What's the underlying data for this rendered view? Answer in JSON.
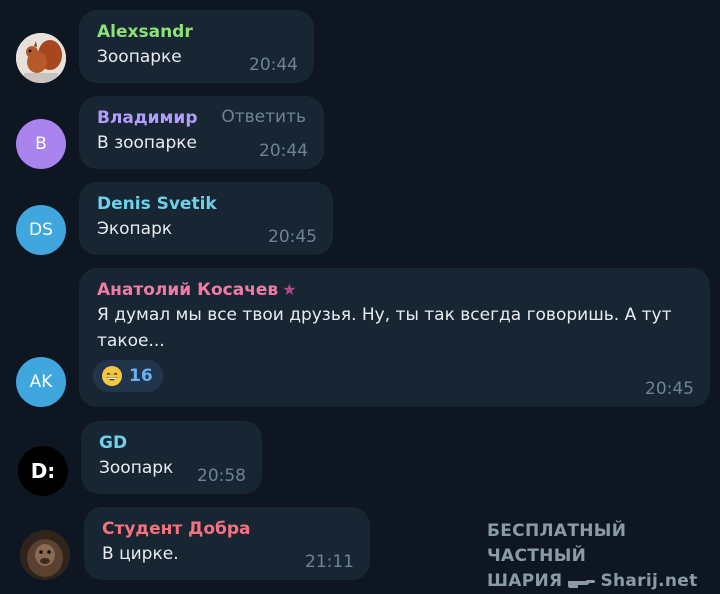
{
  "messages": [
    {
      "sender": "Alexsandr",
      "text": "Зоопарке",
      "time": "20:44",
      "color": "#8ee07a",
      "avatar": {
        "kind": "image",
        "icon": "squirrel-icon"
      }
    },
    {
      "sender": "Владимир",
      "text": "В зоопарке",
      "time": "20:44",
      "color": "#b29dfb",
      "reply": "Ответить",
      "avatar": {
        "kind": "initials",
        "initials": "B",
        "bg": "#a983ee"
      }
    },
    {
      "sender": "Denis Svetik",
      "text": "Экопарк",
      "time": "20:45",
      "color": "#6fd0e8",
      "avatar": {
        "kind": "initials",
        "initials": "DS",
        "bg": "#3fa7de"
      }
    },
    {
      "sender": "Анатолий Косачев",
      "text": "Я думал мы все твои друзья. Ну, ты так всегда говоришь. А тут такое...",
      "time": "20:45",
      "color": "#f27aa6",
      "badge_icon": "star-icon",
      "reaction": {
        "emoji_icon": "grinning-emoji-icon",
        "count": "16"
      },
      "avatar": {
        "kind": "initials",
        "initials": "AK",
        "bg": "#3fa7de"
      }
    },
    {
      "sender": "GD",
      "text": "Зоопарк",
      "time": "20:58",
      "color": "#6fd0e8",
      "avatar": {
        "kind": "logo",
        "logo": "D:",
        "bg": "#000000"
      }
    },
    {
      "sender": "Студент Добра",
      "text": "В цирке.",
      "time": "21:11",
      "color": "#f5737d",
      "avatar": {
        "kind": "image",
        "icon": "gorilla-icon"
      }
    }
  ],
  "watermark": {
    "line1": "БЕСПЛАТНЫЙ ЧАСТНЫЙ",
    "line2_left": "ШАРИЯ",
    "line2_right": "Sharij.net",
    "icon": "pointing-hand-icon"
  }
}
